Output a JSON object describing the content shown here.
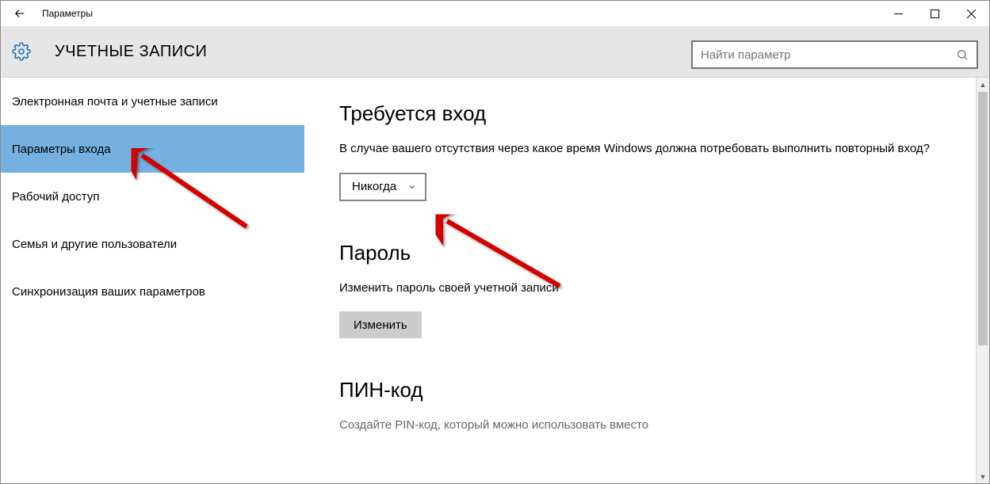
{
  "window": {
    "title": "Параметры"
  },
  "header": {
    "title": "УЧЕТНЫЕ ЗАПИСИ"
  },
  "search": {
    "placeholder": "Найти параметр"
  },
  "sidebar": {
    "items": [
      {
        "label": "Электронная почта и учетные записи",
        "selected": false
      },
      {
        "label": "Параметры входа",
        "selected": true
      },
      {
        "label": "Рабочий доступ",
        "selected": false
      },
      {
        "label": "Семья и другие пользователи",
        "selected": false
      },
      {
        "label": "Синхронизация ваших параметров",
        "selected": false
      }
    ]
  },
  "content": {
    "signin_required": {
      "heading": "Требуется вход",
      "description": "В случае вашего отсутствия через какое время Windows должна потребовать выполнить повторный вход?",
      "dropdown_value": "Никогда"
    },
    "password": {
      "heading": "Пароль",
      "description": "Изменить пароль своей учетной записи",
      "button": "Изменить"
    },
    "pin": {
      "heading": "ПИН-код",
      "description_partial": "Создайте PIN-код, который можно использовать вместо"
    }
  }
}
